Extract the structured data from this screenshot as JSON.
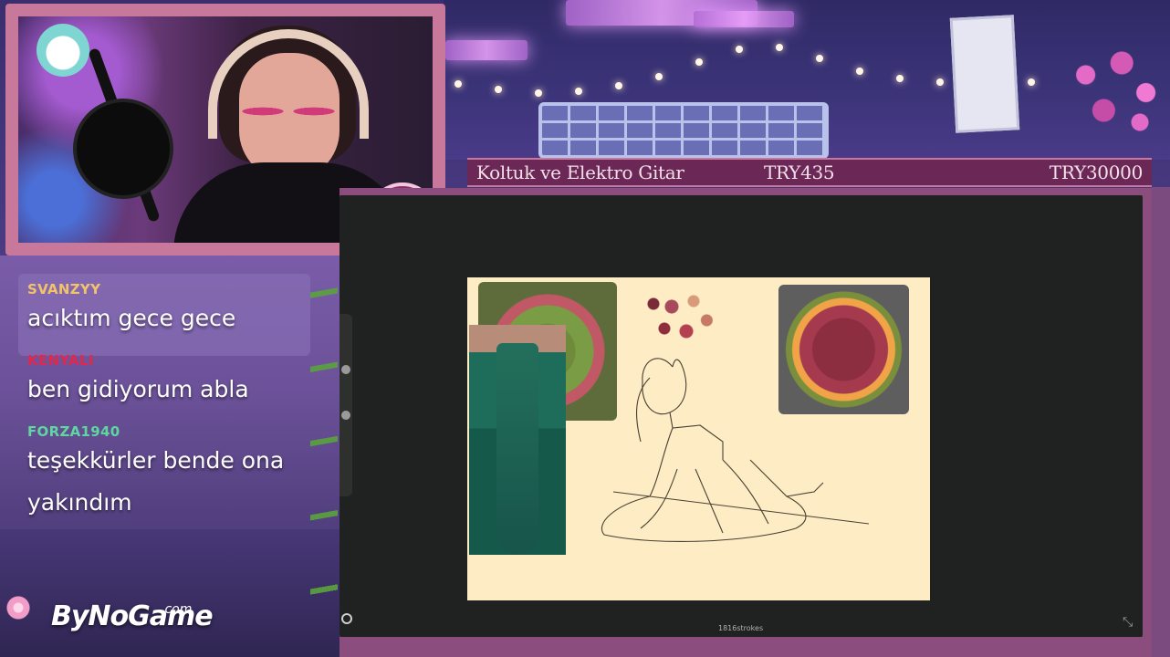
{
  "stream_info": {
    "item_name": "Koltuk ve Elektro Gitar",
    "current_amount": "TRY435",
    "goal_amount": "TRY30000"
  },
  "chat": {
    "messages": [
      {
        "user": "SVANZYY",
        "user_color": "#f2c36b",
        "text": "acıktım gece gece"
      },
      {
        "user": "KENYALI",
        "user_color": "#e0284d",
        "text": "ben gidiyorum abla"
      },
      {
        "user": "FORZA1940",
        "user_color": "#5fd6a0",
        "text": "teşekkürler bende ona yakındım"
      }
    ]
  },
  "branding": {
    "logo_text": "ByNoGame",
    "logo_suffix": ".com"
  },
  "canvas": {
    "stroke_count": "1816strokes"
  },
  "colors": {
    "frame_pink": "#c8789a",
    "info_bar": "#6b2756",
    "canvas_bg": "#1f2220",
    "paper": "#fdecc4"
  },
  "icons": {
    "webcam_badge": "flower-badge-icon",
    "logo_mark": "sakura-icon",
    "canvas_corner": "collapse-icon",
    "canvas_tool": "circle-tool-icon"
  }
}
